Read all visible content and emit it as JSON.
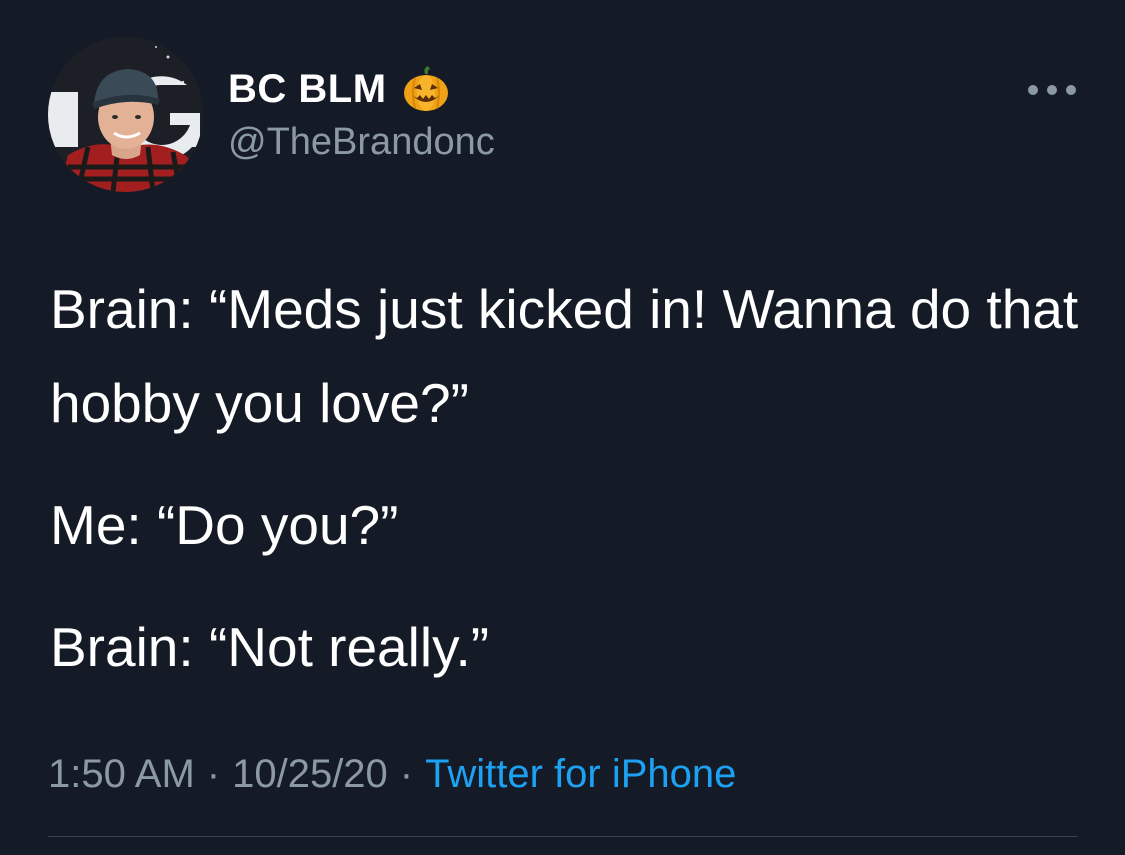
{
  "author": {
    "display_name": "BC BLM",
    "name_emoji": "jack-o-lantern-icon",
    "handle": "@TheBrandonc",
    "avatar": "profile-photo"
  },
  "tweet": {
    "paragraphs": [
      "Brain: “Meds just kicked in! Wanna do that hobby you love?”",
      "Me: “Do you?”",
      "Brain: “Not really.”"
    ],
    "time": "1:50 AM",
    "date": "10/25/20",
    "separator": "·",
    "source": "Twitter for iPhone"
  },
  "icons": {
    "more": "more-options-icon"
  },
  "colors": {
    "background": "#151b26",
    "primary_text": "#ffffff",
    "secondary_text": "#8b98a5",
    "link": "#1da1f2"
  }
}
